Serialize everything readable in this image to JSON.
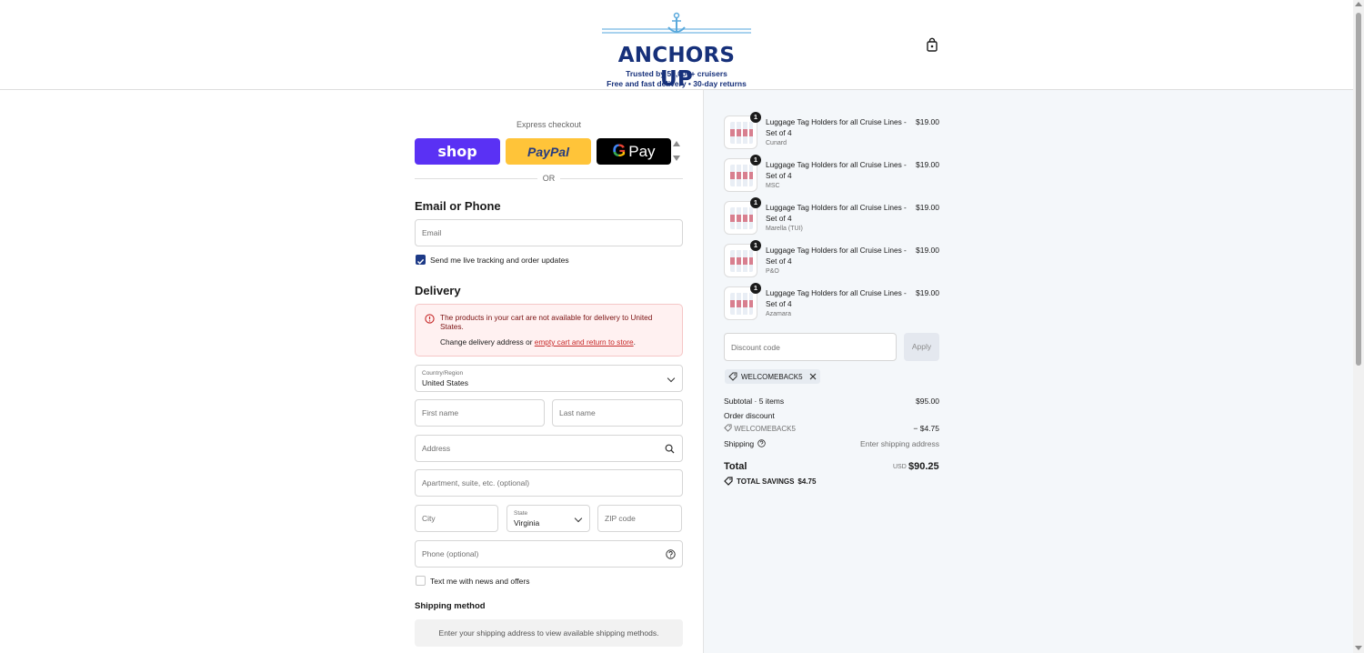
{
  "header": {
    "brand": "ANCHORS UP",
    "tagline1": "Trusted by 50,000+ cruisers",
    "tagline2": "Free and fast delivery • 30-day returns"
  },
  "express": {
    "label": "Express checkout",
    "shop": "shop",
    "paypal": "PayPal",
    "gpay": "Pay",
    "or": "OR"
  },
  "contact": {
    "heading": "Email or Phone",
    "email_placeholder": "Email",
    "tracking_label": "Send me live tracking and order updates",
    "tracking_checked": true
  },
  "delivery": {
    "heading": "Delivery",
    "alert_message": "The products in your cart are not available for delivery to United States.",
    "alert_sub_prefix": "Change delivery address or ",
    "alert_link": "empty cart and return to store",
    "alert_suffix": ".",
    "country_label": "Country/Region",
    "country_value": "United States",
    "first_name_placeholder": "First name",
    "last_name_placeholder": "Last name",
    "address_placeholder": "Address",
    "apartment_placeholder": "Apartment, suite, etc. (optional)",
    "city_placeholder": "City",
    "state_label": "State",
    "state_value": "Virginia",
    "zip_placeholder": "ZIP code",
    "phone_placeholder": "Phone (optional)",
    "news_label": "Text me with news and offers",
    "news_checked": false
  },
  "shipping": {
    "heading": "Shipping method",
    "message": "Enter your shipping address to view available shipping methods."
  },
  "cart": {
    "items": [
      {
        "qty": "1",
        "name": "Luggage Tag Holders for all Cruise Lines - Set of 4",
        "variant": "Cunard",
        "price": "$19.00"
      },
      {
        "qty": "1",
        "name": "Luggage Tag Holders for all Cruise Lines - Set of 4",
        "variant": "MSC",
        "price": "$19.00"
      },
      {
        "qty": "1",
        "name": "Luggage Tag Holders for all Cruise Lines - Set of 4",
        "variant": "Marella (TUI)",
        "price": "$19.00"
      },
      {
        "qty": "1",
        "name": "Luggage Tag Holders for all Cruise Lines - Set of 4",
        "variant": "P&O",
        "price": "$19.00"
      },
      {
        "qty": "1",
        "name": "Luggage Tag Holders for all Cruise Lines - Set of 4",
        "variant": "Azamara",
        "price": "$19.00"
      }
    ],
    "discount_placeholder": "Discount code",
    "apply_label": "Apply",
    "applied_code": "WELCOMEBACK5",
    "subtotal_label": "Subtotal · 5 items",
    "subtotal_value": "$95.00",
    "order_discount_label": "Order discount",
    "order_discount_code": "WELCOMEBACK5",
    "order_discount_value": "− $4.75",
    "shipping_label": "Shipping",
    "shipping_value": "Enter shipping address",
    "total_label": "Total",
    "total_currency": "USD",
    "total_value": "$90.25",
    "savings_label": "TOTAL SAVINGS",
    "savings_value": "$4.75"
  },
  "colors": {
    "brand": "#16307a",
    "checkbox": "#1d3a87",
    "shop": "#5a31f4",
    "paypal": "#ffc439",
    "alert_bg": "#fff1f1",
    "summary_bg": "#f4f7fa"
  }
}
